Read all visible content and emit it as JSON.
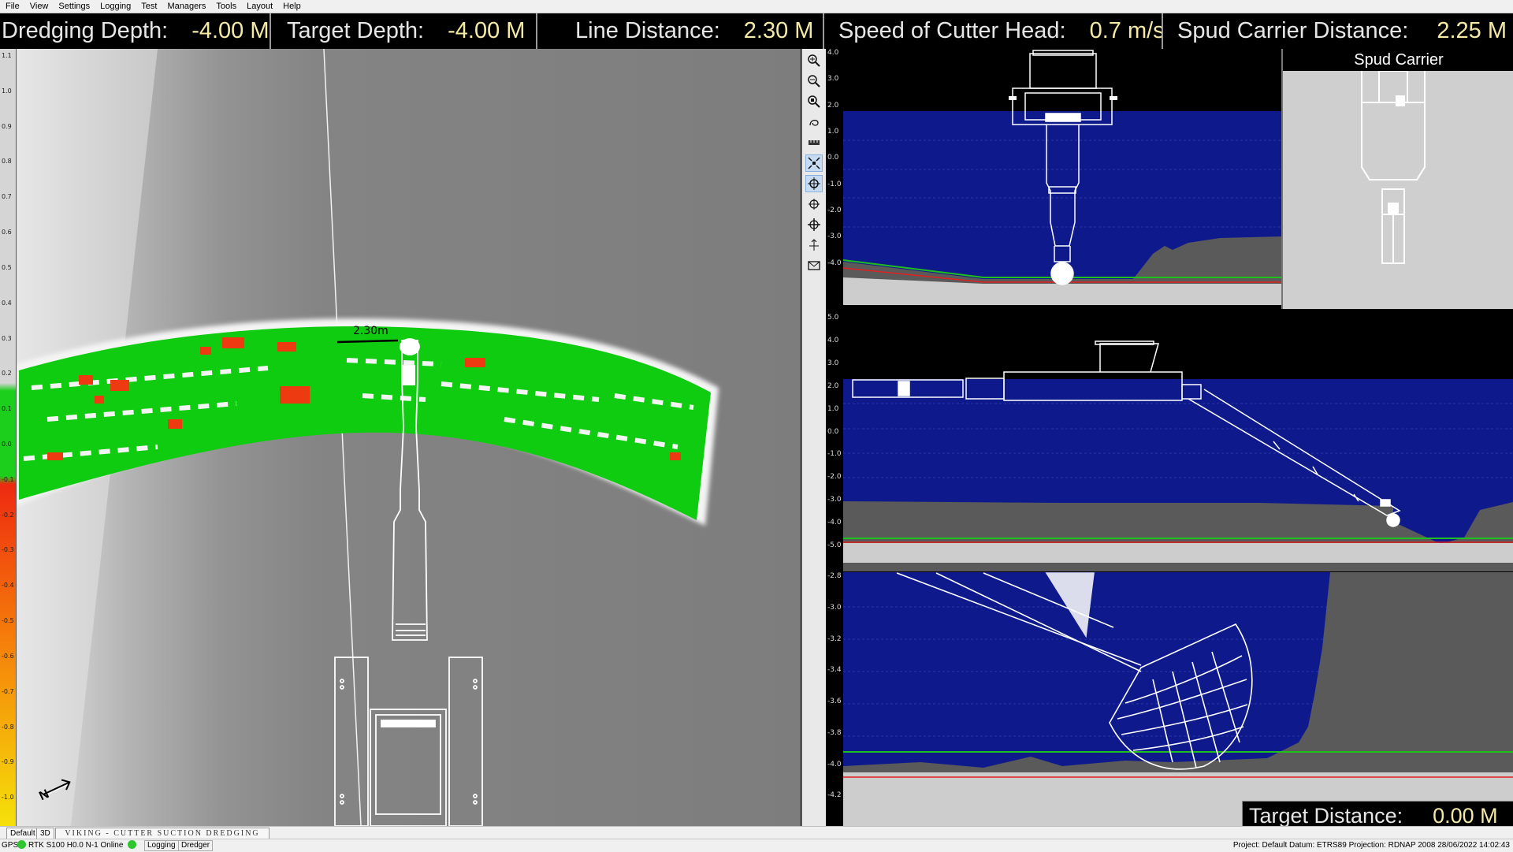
{
  "menu": [
    "File",
    "View",
    "Settings",
    "Logging",
    "Test",
    "Managers",
    "Tools",
    "Layout",
    "Help"
  ],
  "infobar": [
    {
      "label": "Dredging Depth:",
      "value": "-4.00 M"
    },
    {
      "label": "Target Depth:",
      "value": "-4.00 M"
    },
    {
      "label": "Line Distance:",
      "value": "2.30 M"
    },
    {
      "label": "Speed of Cutter Head:",
      "value": "0.7 m/s"
    },
    {
      "label": "Spud Carrier Distance:",
      "value": "2.25 M"
    }
  ],
  "plan_view": {
    "color_scale": [
      "1.1",
      "1.0",
      "0.9",
      "0.8",
      "0.7",
      "0.6",
      "0.5",
      "0.4",
      "0.3",
      "0.2",
      "0.1",
      "0.0",
      "-0.1",
      "-0.2",
      "-0.3",
      "-0.4",
      "-0.5",
      "-0.6",
      "-0.7",
      "-0.8",
      "-0.9",
      "-1.0"
    ],
    "line_distance_label": "2.30m",
    "north_label": "N"
  },
  "toolbar_icons": [
    "zoom-in-icon",
    "zoom-out-icon",
    "zoom-fit-icon",
    "pan-icon",
    "measure-icon",
    "center-vessel-icon",
    "target-icon",
    "crosshair-icon",
    "move-icon",
    "north-icon",
    "envelope-icon"
  ],
  "profiles": {
    "top_axis": [
      "4.0",
      "3.0",
      "2.0",
      "1.0",
      "0.0",
      "-1.0",
      "-2.0",
      "-3.0",
      "-4.0"
    ],
    "middle_axis": [
      "5.0",
      "4.0",
      "3.0",
      "2.0",
      "1.0",
      "0.0",
      "-1.0",
      "-2.0",
      "-3.0",
      "-4.0",
      "-5.0"
    ],
    "bottom_axis": [
      "-2.8",
      "-3.0",
      "-3.2",
      "-3.4",
      "-3.6",
      "-3.8",
      "-4.0",
      "-4.2"
    ]
  },
  "spud_carrier": {
    "title": "Spud Carrier"
  },
  "target_distance": {
    "label": "Target Distance:",
    "value": "0.00 M"
  },
  "tabs": {
    "default": "Default",
    "three_d": "3D",
    "banner": "VIKING - CUTTER SUCTION DREDGING"
  },
  "status": {
    "gps": "GPS",
    "rtk": "RTK S100 H0.0 N-1 Online",
    "logging": "Logging",
    "dredger": "Dredger",
    "right": "Project: Default  Datum: ETRS89  Projection: RDNAP 2008  28/06/2022 14:02:43"
  },
  "colors": {
    "water": "#0e1a8c",
    "seabed": "#5a5a5a",
    "target_line": "#e02020",
    "design_line": "#1fbf1f",
    "dredged": "#10cc10",
    "under": "#ee3a10"
  }
}
